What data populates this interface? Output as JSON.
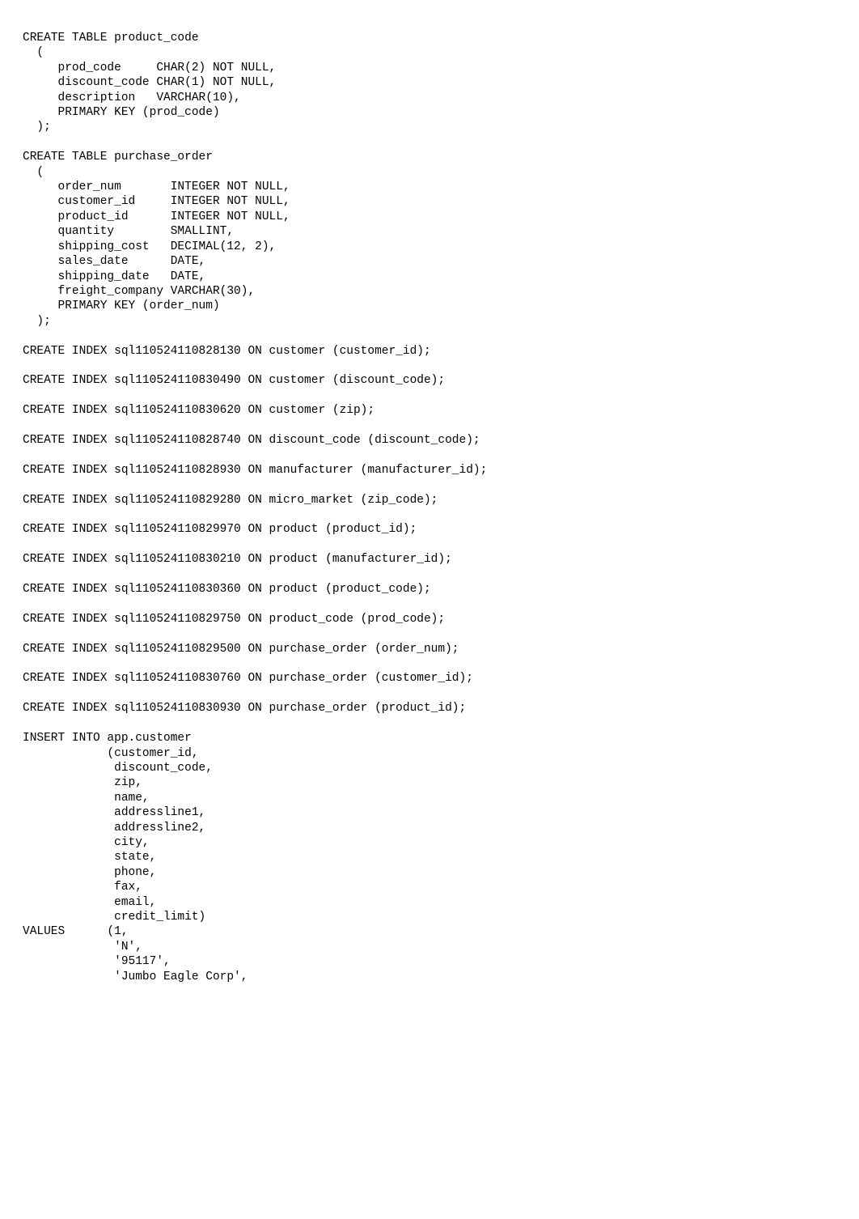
{
  "sql": {
    "create_product_code": "CREATE TABLE product_code\n  (\n     prod_code     CHAR(2) NOT NULL,\n     discount_code CHAR(1) NOT NULL,\n     description   VARCHAR(10),\n     PRIMARY KEY (prod_code)\n  );\n\n",
    "create_purchase_order": "CREATE TABLE purchase_order\n  (\n     order_num       INTEGER NOT NULL,\n     customer_id     INTEGER NOT NULL,\n     product_id      INTEGER NOT NULL,\n     quantity        SMALLINT,\n     shipping_cost   DECIMAL(12, 2),\n     sales_date      DATE,\n     shipping_date   DATE,\n     freight_company VARCHAR(30),\n     PRIMARY KEY (order_num)\n  );\n\n",
    "idx1": "CREATE INDEX sql110524110828130 ON customer (customer_id);\n\n",
    "idx2": "CREATE INDEX sql110524110830490 ON customer (discount_code);\n\n",
    "idx3": "CREATE INDEX sql110524110830620 ON customer (zip);\n\n",
    "idx4": "CREATE INDEX sql110524110828740 ON discount_code (discount_code);\n\n",
    "idx5": "CREATE INDEX sql110524110828930 ON manufacturer (manufacturer_id);\n\n",
    "idx6": "CREATE INDEX sql110524110829280 ON micro_market (zip_code);\n\n",
    "idx7": "CREATE INDEX sql110524110829970 ON product (product_id);\n\n",
    "idx8": "CREATE INDEX sql110524110830210 ON product (manufacturer_id);\n\n",
    "idx9": "CREATE INDEX sql110524110830360 ON product (product_code);\n\n",
    "idx10": "CREATE INDEX sql110524110829750 ON product_code (prod_code);\n\n",
    "idx11": "CREATE INDEX sql110524110829500 ON purchase_order (order_num);\n\n",
    "idx12": "CREATE INDEX sql110524110830760 ON purchase_order (customer_id);\n\n",
    "idx13": "CREATE INDEX sql110524110830930 ON purchase_order (product_id);\n\n",
    "insert_customer": "INSERT INTO app.customer\n            (customer_id,\n             discount_code,\n             zip,\n             name,\n             addressline1,\n             addressline2,\n             city,\n             state,\n             phone,\n             fax,\n             email,\n             credit_limit)\nVALUES      (1,\n             'N',\n             '95117',\n             'Jumbo Eagle Corp',"
  }
}
